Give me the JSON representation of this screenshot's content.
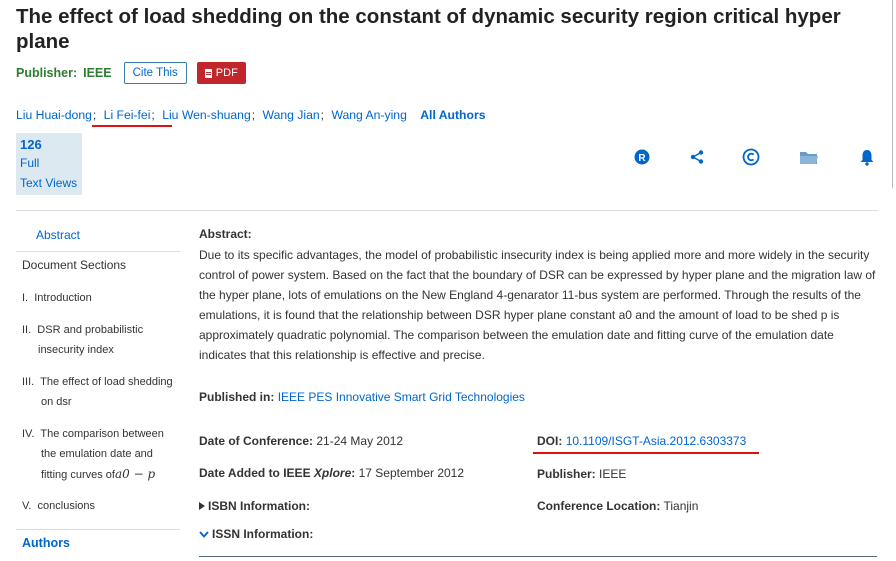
{
  "title": "The effect of load shedding on the constant of dynamic security region critical hyper plane",
  "publisher_row": {
    "label": "Publisher:",
    "value": "IEEE",
    "cite_label": "Cite This",
    "pdf_label": "PDF"
  },
  "authors": {
    "names": [
      "Liu Huai-dong",
      "Li Fei-fei",
      "Liu Wen-shuang",
      "Wang Jian",
      "Wang An-ying"
    ],
    "separator": ";",
    "all_label": "All Authors"
  },
  "views": {
    "count": "126",
    "line1": "Full",
    "line2": "Text Views"
  },
  "actions": [
    {
      "name": "rights-icon",
      "glyph": "R"
    },
    {
      "name": "share-icon",
      "glyph": "share"
    },
    {
      "name": "copyright-icon",
      "glyph": "©"
    },
    {
      "name": "folder-icon",
      "glyph": "folder"
    },
    {
      "name": "alert-bell-icon",
      "glyph": "bell"
    }
  ],
  "sidebar": {
    "abstract": "Abstract",
    "sections_title": "Document Sections",
    "items": [
      {
        "num": "I.",
        "lines": [
          "Introduction"
        ]
      },
      {
        "num": "II.",
        "lines": [
          "DSR and probabilistic",
          "insecurity index"
        ]
      },
      {
        "num": "III.",
        "lines": [
          "The effect of load shedding",
          "on dsr"
        ]
      },
      {
        "num": "IV.",
        "lines": [
          "The comparison between",
          "the emulation date and",
          "fitting curves of"
        ]
      },
      {
        "num": "V.",
        "lines": [
          "conclusions"
        ]
      }
    ],
    "formula_tail": "a0 − p",
    "authors_label": "Authors"
  },
  "abstract": {
    "label": "Abstract:",
    "text": "Due to its specific advantages, the model of probabilistic insecurity index is being applied more and more widely in the security control of power system. Based on the fact that the boundary of DSR can be expressed by hyper plane and the migration law of the hyper plane, lots of emulations on the New England 4-genarator 11-bus system are performed. Through the results of the emulations, it is found that the relationship between DSR hyper plane constant a0 and the amount of load to be shed p is approximately quadratic polynomial. The comparison between the emulation date and fitting curve of the emulation date indicates that this relationship is effective and precise."
  },
  "meta": {
    "published_in_label": "Published in:",
    "published_in_value": "IEEE PES Innovative Smart Grid Technologies",
    "conf_date_label": "Date of Conference:",
    "conf_date_value": "21-24 May 2012",
    "date_added_label_pre": "Date Added to IEEE",
    "date_added_label_em": "Xplore",
    "date_added_label_post": ":",
    "date_added_value": "17 September 2012",
    "isbn_label": "ISBN Information:",
    "issn_label": "ISSN Information:",
    "doi_label": "DOI:",
    "doi_value": "10.1109/ISGT-Asia.2012.6303373",
    "publisher_label": "Publisher:",
    "publisher_value": "IEEE",
    "location_label": "Conference Location:",
    "location_value": "Tianjin"
  }
}
